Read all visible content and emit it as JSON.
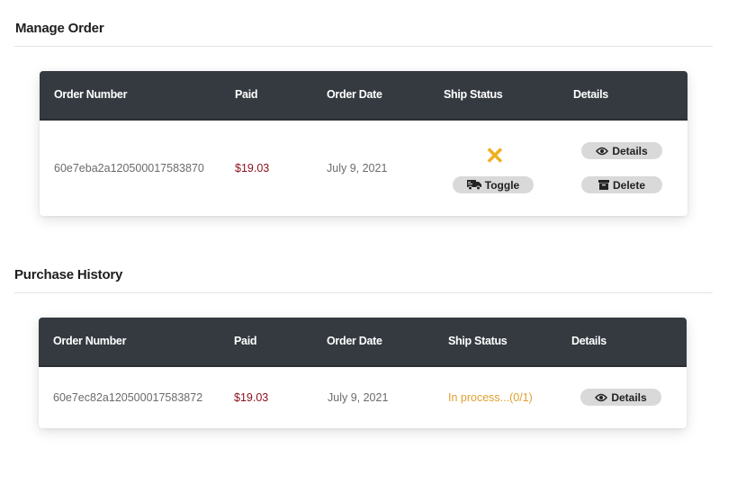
{
  "manage_order": {
    "title": "Manage Order",
    "headers": [
      "Order Number",
      "Paid",
      "Order Date",
      "Ship Status",
      "Details"
    ],
    "row": {
      "order_number": "60e7eba2a120500017583870",
      "paid": "$19.03",
      "order_date": "July 9, 2021",
      "ship_status_icon": "x-mark-icon",
      "toggle_label": "Toggle",
      "details_label": "Details",
      "delete_label": "Delete"
    }
  },
  "purchase_history": {
    "title": "Purchase History",
    "headers": [
      "Order Number",
      "Paid",
      "Order Date",
      "Ship Status",
      "Details"
    ],
    "row": {
      "order_number": "60e7ec82a120500017583872",
      "paid": "$19.03",
      "order_date": "July 9, 2021",
      "ship_status": "In process...(0/1)",
      "details_label": "Details"
    }
  },
  "colors": {
    "header_bg": "#343a40",
    "paid": "#8b0f1a",
    "pending_icon": "#f0ae1e",
    "processing_text": "#e0a02e",
    "button_bg": "#d9d9d9"
  }
}
